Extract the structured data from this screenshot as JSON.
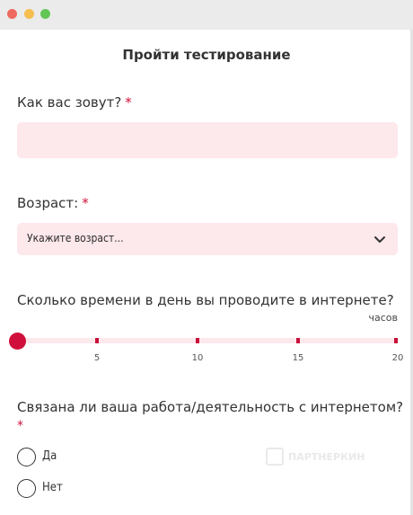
{
  "window": {
    "controls": [
      "close",
      "minimize",
      "maximize"
    ]
  },
  "form": {
    "title": "Пройти тестирование",
    "name_question": {
      "label": "Как вас зовут?",
      "required_mark": "*",
      "value": ""
    },
    "age_question": {
      "label": "Возраст:",
      "required_mark": "*",
      "selected": "Укажите возраст...",
      "icon": "chevron-down-icon"
    },
    "time_question": {
      "label": "Сколько времени в день вы проводите в интернете?",
      "unit": "часов",
      "slider_min": 0,
      "slider_max": 20,
      "slider_value": 0,
      "ticks": [
        "5",
        "10",
        "15",
        "20"
      ]
    },
    "work_question": {
      "label": "Связана ли ваша работа/деятельность с интернетом?",
      "required_mark": "*",
      "options": [
        "Да",
        "Нет"
      ]
    }
  },
  "watermark": {
    "text": "ПАРТНЕРКИН"
  },
  "colors": {
    "accent": "#d0103a",
    "field_bg": "#fde8ec",
    "titlebar": "#ebebeb"
  }
}
